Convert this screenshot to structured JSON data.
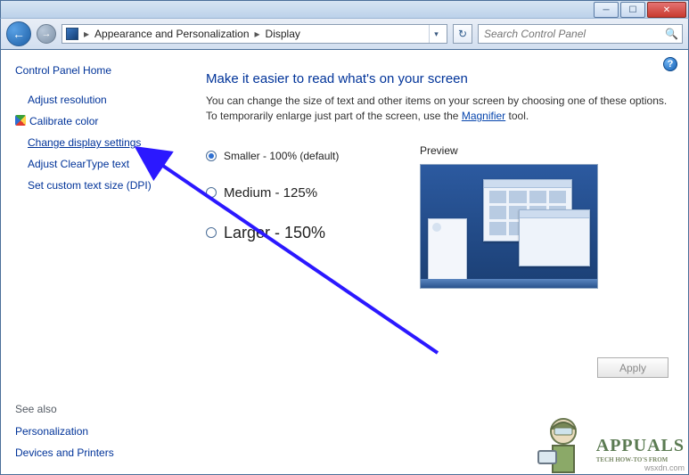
{
  "window": {
    "minimize": "─",
    "maximize": "☐",
    "close": "✕"
  },
  "toolbar": {
    "back_glyph": "←",
    "forward_glyph": "→",
    "breadcrumb1": "Appearance and Personalization",
    "breadcrumb2": "Display",
    "sep": "▸",
    "refresh_glyph": "↻",
    "search_placeholder": "Search Control Panel"
  },
  "sidebar": {
    "home": "Control Panel Home",
    "links": [
      "Adjust resolution",
      "Calibrate color",
      "Change display settings",
      "Adjust ClearType text",
      "Set custom text size (DPI)"
    ],
    "see_also_label": "See also",
    "see_also": [
      "Personalization",
      "Devices and Printers"
    ]
  },
  "main": {
    "help_glyph": "?",
    "heading": "Make it easier to read what's on your screen",
    "desc_a": "You can change the size of text and other items on your screen by choosing one of these options. To temporarily enlarge just part of the screen, use the ",
    "desc_link": "Magnifier",
    "desc_b": " tool.",
    "options": {
      "small": "Smaller - 100% (default)",
      "medium": "Medium - 125%",
      "large": "Larger - 150%"
    },
    "preview_label": "Preview",
    "apply_label": "Apply"
  },
  "watermark": {
    "title": "APPUALS",
    "sub": "TECH HOW-TO'S FROM",
    "host": "wsxdn.com"
  }
}
